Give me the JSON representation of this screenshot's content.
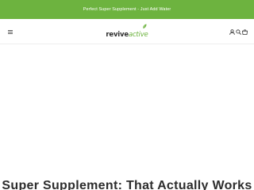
{
  "announcement": {
    "text": "Perfect Super Supplement - Just Add Water"
  },
  "header": {
    "logo_bold": "revive",
    "logo_light": "active",
    "menu_icon": "hamburger-icon",
    "account_icon": "account-icon",
    "search_icon": "search-icon",
    "cart_icon": "cart-icon"
  },
  "hero": {
    "heading_partial": "Super Supplement: That Actually Works"
  },
  "colors": {
    "brand_green": "#6db33f",
    "text_dark": "#2d2d2d"
  }
}
